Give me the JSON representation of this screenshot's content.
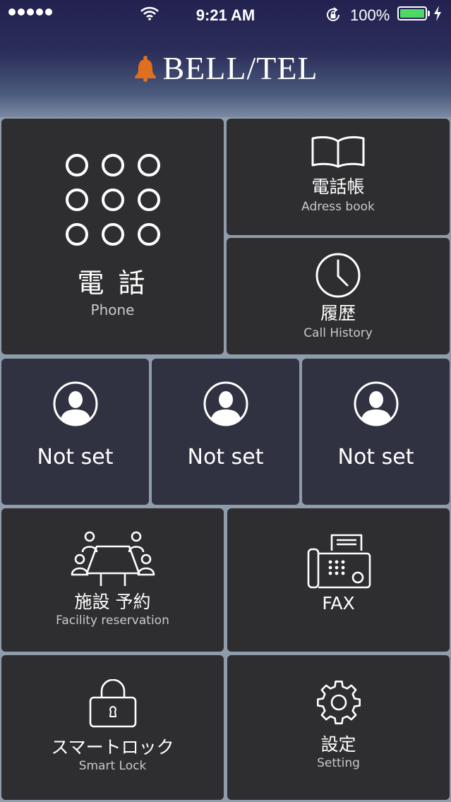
{
  "status_bar": {
    "time": "9:21 AM",
    "battery_percent": "100%",
    "battery_level": 1.0,
    "battery_color": "#4cd964"
  },
  "logo": {
    "icon": "bell-icon",
    "icon_color": "#e0701f",
    "text": "BELL/TEL"
  },
  "tiles": {
    "phone": {
      "icon": "dialpad-icon",
      "label_jp": "電 話",
      "label_en": "Phone"
    },
    "address_book": {
      "icon": "book-icon",
      "label_jp": "電話帳",
      "label_en": "Adress book"
    },
    "call_history": {
      "icon": "clock-icon",
      "label_jp": "履歴",
      "label_en": "Call History"
    },
    "contacts": [
      {
        "icon": "person-icon",
        "label": "Not set"
      },
      {
        "icon": "person-icon",
        "label": "Not set"
      },
      {
        "icon": "person-icon",
        "label": "Not set"
      }
    ],
    "facility": {
      "icon": "meeting-table-icon",
      "label_jp": "施設 予約",
      "label_en": "Facility reservation"
    },
    "fax": {
      "icon": "fax-icon",
      "label": "FAX"
    },
    "smart_lock": {
      "icon": "padlock-icon",
      "label_jp": "スマートロック",
      "label_en": "Smart Lock"
    },
    "settings": {
      "icon": "gear-icon",
      "label_jp": "設定",
      "label_en": "Setting"
    }
  },
  "colors": {
    "tile_background": "#2e2e30",
    "contact_tile_background": "#303242",
    "grid_gap": "#8f9cab"
  }
}
